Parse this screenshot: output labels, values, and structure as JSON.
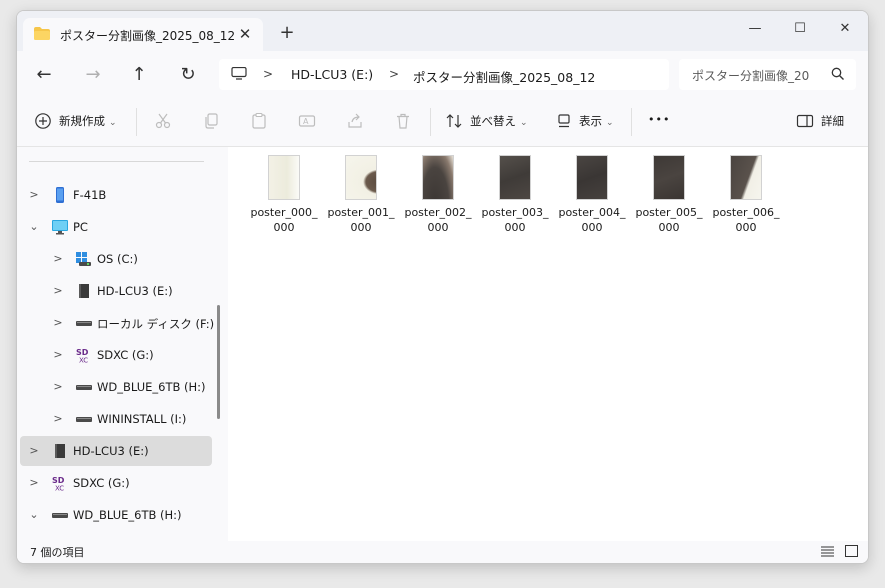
{
  "tab": {
    "title": "ポスター分割画像_2025_08_12",
    "close": "✕",
    "new": "+"
  },
  "window_controls": {
    "minimize": "—",
    "maximize": "☐",
    "close": "✕"
  },
  "nav": {
    "back": "←",
    "forward": "→",
    "up": "↑",
    "refresh": "↻"
  },
  "address": {
    "separator": ">",
    "crumbs": [
      "HD-LCU3 (E:)",
      "ポスター分割画像_2025_08_12"
    ]
  },
  "search": {
    "placeholder": "ポスター分割画像_20"
  },
  "toolbar": {
    "new_label": "新規作成",
    "sort_label": "並べ替え",
    "view_label": "表示",
    "more": "•••",
    "details_label": "詳細",
    "chevron": "⌄"
  },
  "sidebar": {
    "items": [
      {
        "label": "F-41B",
        "icon": "phone-icon",
        "expander": ">"
      },
      {
        "label": "PC",
        "icon": "pc-icon",
        "expander": "⌄"
      },
      {
        "label": "OS (C:)",
        "icon": "os-drive-icon",
        "expander": ">"
      },
      {
        "label": "HD-LCU3 (E:)",
        "icon": "external-drive-icon",
        "expander": ">"
      },
      {
        "label": "ローカル ディスク (F:)",
        "icon": "disk-drive-icon",
        "expander": ">"
      },
      {
        "label": "SDXC (G:)",
        "icon": "sd-card-icon",
        "expander": ">"
      },
      {
        "label": "WD_BLUE_6TB (H:)",
        "icon": "disk-drive-icon",
        "expander": ">"
      },
      {
        "label": "WININSTALL (I:)",
        "icon": "disk-drive-icon",
        "expander": ">"
      },
      {
        "label": "HD-LCU3 (E:)",
        "icon": "external-drive-icon",
        "expander": ">"
      },
      {
        "label": "SDXC (G:)",
        "icon": "sd-card-icon",
        "expander": ">"
      },
      {
        "label": "WD_BLUE_6TB (H:)",
        "icon": "disk-drive-icon",
        "expander": "⌄"
      }
    ]
  },
  "files": [
    {
      "name": "poster_000_000",
      "line1": "poster_000_",
      "line2": "000"
    },
    {
      "name": "poster_001_000",
      "line1": "poster_001_",
      "line2": "000"
    },
    {
      "name": "poster_002_000",
      "line1": "poster_002_",
      "line2": "000"
    },
    {
      "name": "poster_003_000",
      "line1": "poster_003_",
      "line2": "000"
    },
    {
      "name": "poster_004_000",
      "line1": "poster_004_",
      "line2": "000"
    },
    {
      "name": "poster_005_000",
      "line1": "poster_005_",
      "line2": "000"
    },
    {
      "name": "poster_006_000",
      "line1": "poster_006_",
      "line2": "000"
    }
  ],
  "status": {
    "count_text": "7 個の項目"
  },
  "colors": {
    "accent": "#0067c0",
    "folder": "#f6c64a",
    "selected": "#dcdcdc"
  }
}
